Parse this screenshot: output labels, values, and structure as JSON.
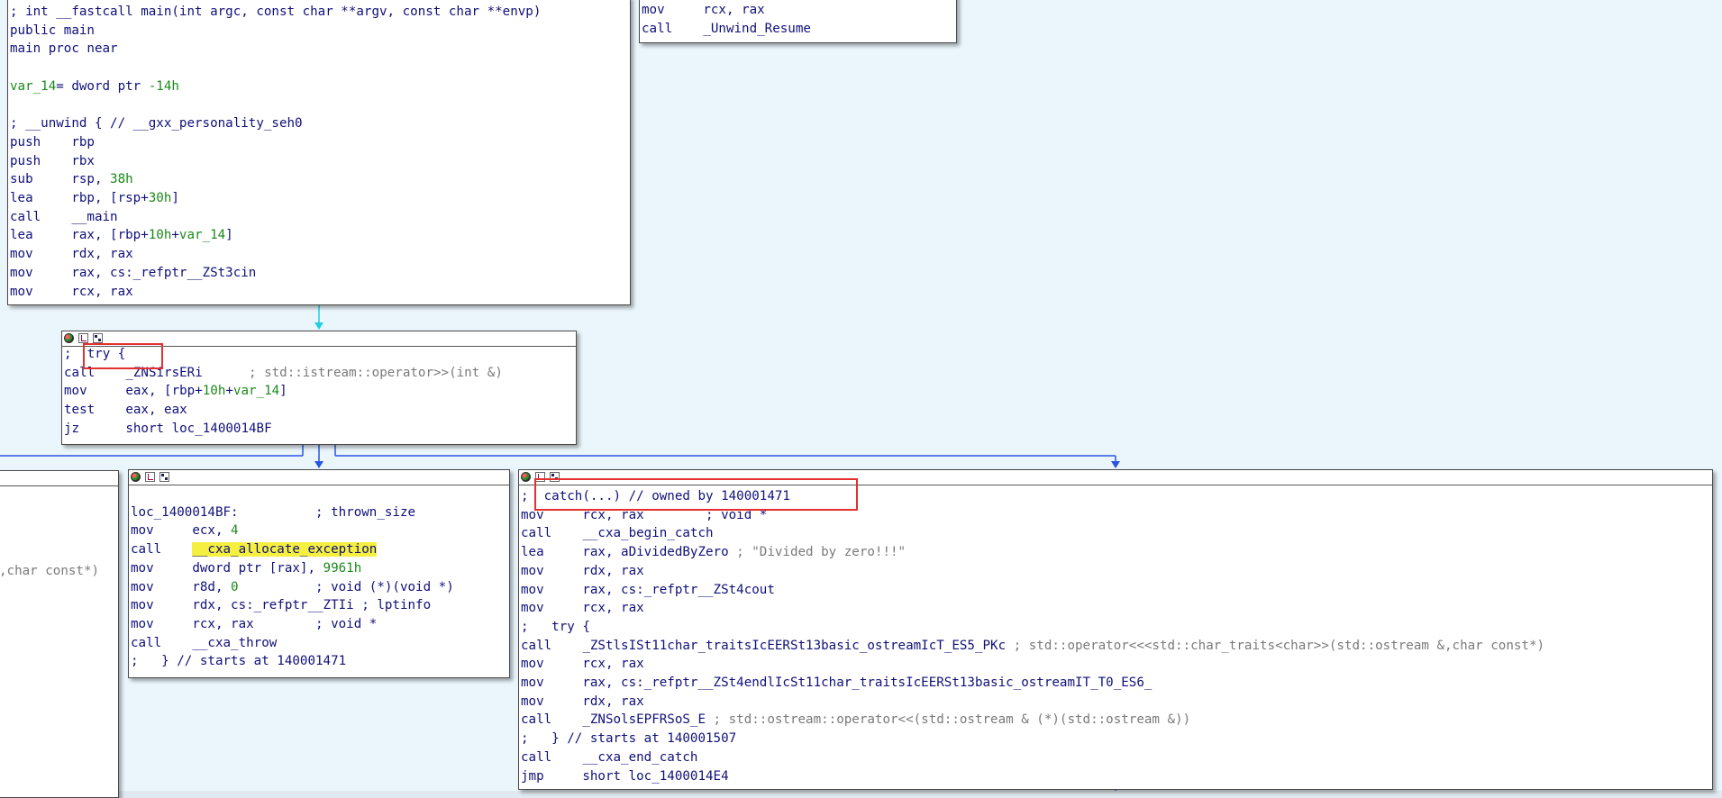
{
  "colors": {
    "background": "#eaf6fc",
    "edge_blue": "#2a55e0",
    "edge_cyan": "#20d0e0",
    "highlight": "#f5f040",
    "callout_red": "#e53030"
  },
  "block_main": {
    "lines": [
      [
        {
          "t": "; int __fastcall main(int argc, const char **argv, const char **envp)",
          "c": "c-comment"
        }
      ],
      [
        {
          "t": "public main",
          "c": "c-name"
        }
      ],
      [
        {
          "t": "main proc near",
          "c": "c-name"
        }
      ],
      [
        {
          "t": "",
          "c": "c-name"
        }
      ],
      [
        {
          "t": "var_14",
          "c": "c-green"
        },
        {
          "t": "= dword ptr ",
          "c": "c-name"
        },
        {
          "t": "-14h",
          "c": "c-green"
        }
      ],
      [
        {
          "t": "",
          "c": "c-name"
        }
      ],
      [
        {
          "t": "; __unwind { // __gxx_personality_seh0",
          "c": "c-comment"
        }
      ],
      [
        {
          "t": "push    rbp",
          "c": "c-mn"
        }
      ],
      [
        {
          "t": "push    rbx",
          "c": "c-mn"
        }
      ],
      [
        {
          "t": "sub     rsp, ",
          "c": "c-mn"
        },
        {
          "t": "38h",
          "c": "c-green"
        }
      ],
      [
        {
          "t": "lea     rbp, [rsp+",
          "c": "c-mn"
        },
        {
          "t": "30h",
          "c": "c-green"
        },
        {
          "t": "]",
          "c": "c-mn"
        }
      ],
      [
        {
          "t": "call    __main",
          "c": "c-mn"
        }
      ],
      [
        {
          "t": "lea     rax, [rbp+",
          "c": "c-mn"
        },
        {
          "t": "10h",
          "c": "c-green"
        },
        {
          "t": "+",
          "c": "c-mn"
        },
        {
          "t": "var_14",
          "c": "c-green"
        },
        {
          "t": "]",
          "c": "c-mn"
        }
      ],
      [
        {
          "t": "mov     rdx, rax",
          "c": "c-mn"
        }
      ],
      [
        {
          "t": "mov     rax, cs:_refptr__ZSt3cin",
          "c": "c-mn"
        }
      ],
      [
        {
          "t": "mov     rcx, rax",
          "c": "c-mn"
        }
      ]
    ]
  },
  "block_unwind": {
    "lines": [
      [
        {
          "t": "mov     rcx, rax",
          "c": "c-mn"
        }
      ],
      [
        {
          "t": "call    _Unwind_Resume",
          "c": "c-mn"
        }
      ]
    ]
  },
  "block_try": {
    "lines": [
      [
        {
          "t": ";  try {",
          "c": "c-comment"
        }
      ],
      [
        {
          "t": "call    _ZNSirsERi      ",
          "c": "c-mn"
        },
        {
          "t": "; std::istream::operator>>(int &)",
          "c": "c-gray"
        }
      ],
      [
        {
          "t": "mov     eax, [rbp+",
          "c": "c-mn"
        },
        {
          "t": "10h",
          "c": "c-green"
        },
        {
          "t": "+",
          "c": "c-mn"
        },
        {
          "t": "var_14",
          "c": "c-green"
        },
        {
          "t": "]",
          "c": "c-mn"
        }
      ],
      [
        {
          "t": "test    eax, eax",
          "c": "c-mn"
        }
      ],
      [
        {
          "t": "jz      short loc_1400014BF",
          "c": "c-mn"
        }
      ]
    ]
  },
  "block_left_partial": {
    "lines": [
      [
        {
          "t": ",char const*)",
          "c": "c-gray"
        }
      ]
    ]
  },
  "block_throw": {
    "lines": [
      [
        {
          "t": "",
          "c": "c-name"
        }
      ],
      [
        {
          "t": "loc_1400014BF:          ; thrown_size",
          "c": "c-name"
        }
      ],
      [
        {
          "t": "mov     ecx, ",
          "c": "c-mn"
        },
        {
          "t": "4",
          "c": "c-green"
        }
      ],
      [
        {
          "t": "call    ",
          "c": "c-mn"
        },
        {
          "t": "__cxa_allocate_exception",
          "c": "c-mn hl"
        }
      ],
      [
        {
          "t": "mov     dword ptr [rax], ",
          "c": "c-mn"
        },
        {
          "t": "9961h",
          "c": "c-green"
        }
      ],
      [
        {
          "t": "mov     r8d, ",
          "c": "c-mn"
        },
        {
          "t": "0",
          "c": "c-green"
        },
        {
          "t": "          ; void (*)(void *)",
          "c": "c-comment"
        }
      ],
      [
        {
          "t": "mov     rdx, cs:_refptr__ZTIi ; lptinfo",
          "c": "c-mn"
        }
      ],
      [
        {
          "t": "mov     rcx, rax        ; void *",
          "c": "c-mn"
        }
      ],
      [
        {
          "t": "call    __cxa_throw",
          "c": "c-mn"
        }
      ],
      [
        {
          "t": ";   } // starts at 140001471",
          "c": "c-comment"
        }
      ]
    ]
  },
  "block_catch": {
    "lines": [
      [
        {
          "t": ";  catch(...) // owned by 140001471",
          "c": "c-comment"
        }
      ],
      [
        {
          "t": "mov     rcx, rax        ; void *",
          "c": "c-mn"
        }
      ],
      [
        {
          "t": "call    __cxa_begin_catch",
          "c": "c-mn"
        }
      ],
      [
        {
          "t": "lea     rax, aDividedByZero ",
          "c": "c-mn"
        },
        {
          "t": "; \"Divided by zero!!!\"",
          "c": "c-gray"
        }
      ],
      [
        {
          "t": "mov     rdx, rax",
          "c": "c-mn"
        }
      ],
      [
        {
          "t": "mov     rax, cs:_refptr__ZSt4cout",
          "c": "c-mn"
        }
      ],
      [
        {
          "t": "mov     rcx, rax",
          "c": "c-mn"
        }
      ],
      [
        {
          "t": ";   try {",
          "c": "c-comment"
        }
      ],
      [
        {
          "t": "call    _ZStlsISt11char_traitsIcEERSt13basic_ostreamIcT_ES5_PKc ",
          "c": "c-mn"
        },
        {
          "t": "; std::operator<<<std::char_traits<char>>(std::ostream &,char const*)",
          "c": "c-gray"
        }
      ],
      [
        {
          "t": "mov     rcx, rax",
          "c": "c-mn"
        }
      ],
      [
        {
          "t": "mov     rax, cs:_refptr__ZSt4endlIcSt11char_traitsIcEERSt13basic_ostreamIT_T0_ES6_",
          "c": "c-mn"
        }
      ],
      [
        {
          "t": "mov     rdx, rax",
          "c": "c-mn"
        }
      ],
      [
        {
          "t": "call    _ZNSolsEPFRSoS_E ",
          "c": "c-mn"
        },
        {
          "t": "; std::ostream::operator<<(std::ostream & (*)(std::ostream &))",
          "c": "c-gray"
        }
      ],
      [
        {
          "t": ";   } // starts at 140001507",
          "c": "c-comment"
        }
      ],
      [
        {
          "t": "call    __cxa_end_catch",
          "c": "c-mn"
        }
      ],
      [
        {
          "t": "jmp     short loc_1400014E4",
          "c": "c-mn"
        }
      ]
    ]
  }
}
